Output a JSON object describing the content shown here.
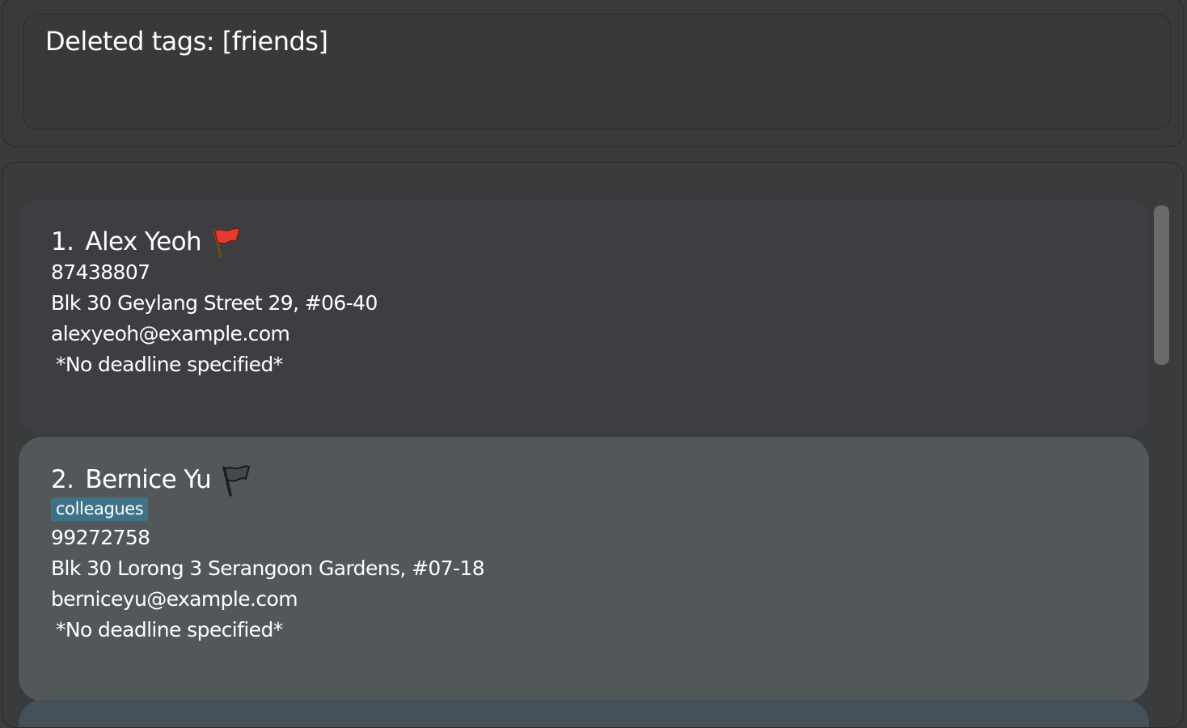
{
  "result_display": {
    "message": "Deleted tags: [friends]"
  },
  "persons": [
    {
      "index": "1.",
      "name": "Alex Yeoh",
      "flag": "red-flag-icon",
      "tags": [],
      "phone": "87438807",
      "address": "Blk 30 Geylang Street 29, #06-40",
      "email": "alexyeoh@example.com",
      "deadline": "*No deadline specified*"
    },
    {
      "index": "2.",
      "name": "Bernice Yu",
      "flag": "black-flag-icon",
      "tags": [
        "colleagues"
      ],
      "phone": "99272758",
      "address": "Blk 30 Lorong 3 Serangoon Gardens, #07-18",
      "email": "berniceyu@example.com",
      "deadline": "*No deadline specified*"
    }
  ],
  "colors": {
    "tag_background": "#3f7188",
    "selected_card": "#52575a",
    "card": "#3d3e41",
    "flag_red": "#e53b2f"
  }
}
